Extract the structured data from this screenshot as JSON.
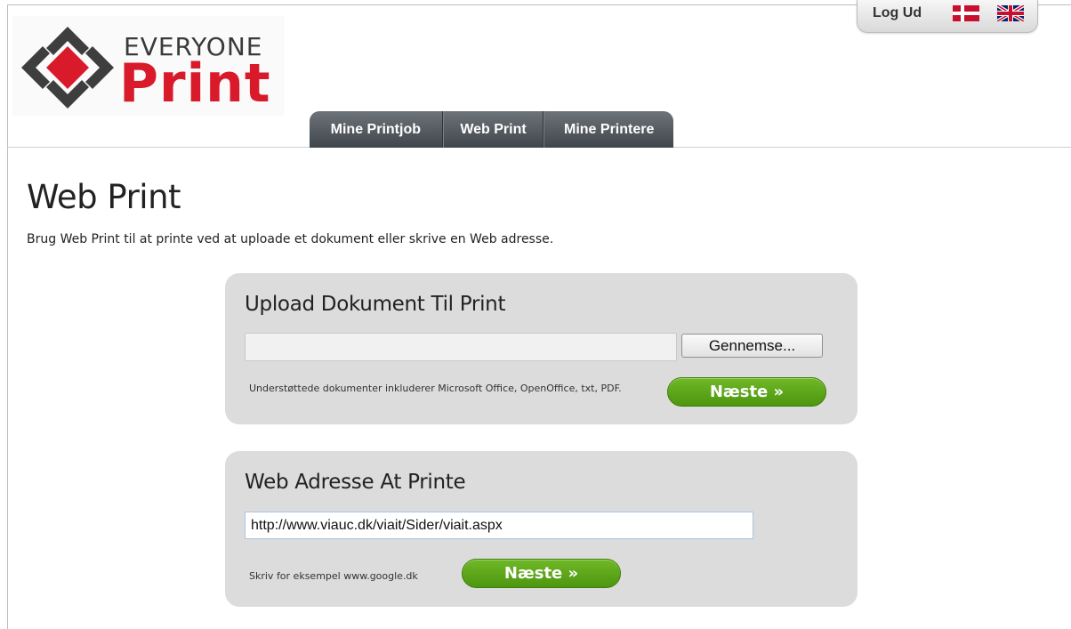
{
  "brand": {
    "top": "EVERYONE",
    "main": "Print"
  },
  "topbar": {
    "logout": "Log Ud"
  },
  "nav": {
    "items": [
      {
        "label": "Mine Printjob"
      },
      {
        "label": "Web Print"
      },
      {
        "label": "Mine Printere"
      }
    ]
  },
  "page": {
    "title": "Web Print",
    "intro": "Brug Web Print til at printe ved at uploade et dokument eller skrive en Web adresse."
  },
  "upload": {
    "title": "Upload Dokument Til Print",
    "file_value": "",
    "browse_label": "Gennemse...",
    "help": "Understøttede dokumenter inkluderer Microsoft Office, OpenOffice, txt, PDF.",
    "next_label": "Næste »"
  },
  "web": {
    "title": "Web Adresse At Printe",
    "url_value": "http://www.viauc.dk/viait/Sider/viait.aspx",
    "help": "Skriv for eksempel www.google.dk",
    "next_label": "Næste »"
  },
  "colors": {
    "accent_red": "#d91a2a",
    "button_green": "#5aa41a",
    "nav_dark": "#4a5055",
    "panel_grey": "#dcdcdc"
  },
  "icons": {
    "logo": "everyone-print-logo-icon",
    "flag_dk": "danish-flag-icon",
    "flag_uk": "uk-flag-icon"
  }
}
